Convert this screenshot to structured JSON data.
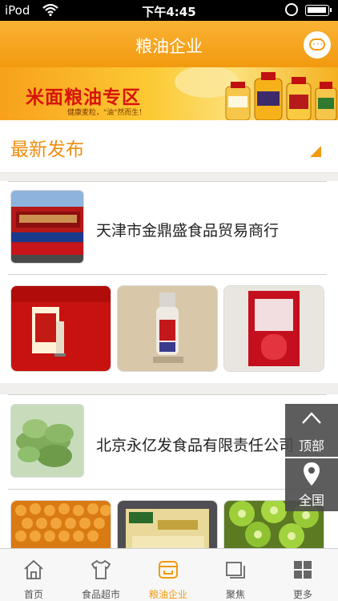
{
  "status_bar": {
    "carrier": "iPod",
    "time": "下午4:45"
  },
  "header": {
    "title": "粮油企业",
    "message_icon": "chat-bubble-icon"
  },
  "banner": {
    "title": "米面粮油专区",
    "subtitle": "健康麦粒，\"油\"然而生！"
  },
  "section": {
    "title": "最新发布"
  },
  "companies": [
    {
      "name": "天津市金鼎盛食品贸易商行"
    },
    {
      "name": "北京永亿发食品有限责任公司"
    }
  ],
  "float_buttons": {
    "top_label": "顶部",
    "all_label": "全国"
  },
  "tabbar": {
    "tabs": [
      {
        "label": "首页",
        "icon": "home-icon",
        "active": false
      },
      {
        "label": "食品超市",
        "icon": "shirt-icon",
        "active": false
      },
      {
        "label": "粮油企业",
        "icon": "store-icon",
        "active": true
      },
      {
        "label": "聚焦",
        "icon": "layers-icon",
        "active": false
      },
      {
        "label": "更多",
        "icon": "grid-icon",
        "active": false
      }
    ]
  },
  "colors": {
    "accent": "#f29a0f",
    "header_top": "#f9b234",
    "banner_red": "#d8140a"
  }
}
